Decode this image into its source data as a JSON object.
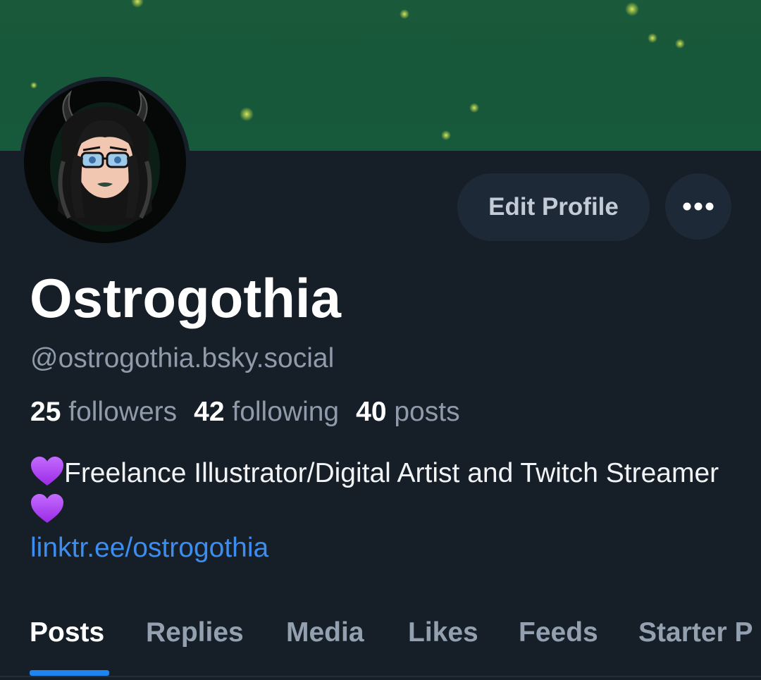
{
  "profile": {
    "display_name": "Ostrogothia",
    "handle": "@ostrogothia.bsky.social",
    "avatar_icon": "avatar-illustration",
    "banner_color": "#17573a"
  },
  "actions": {
    "edit_label": "Edit Profile",
    "more_icon": "ellipsis-icon"
  },
  "stats": {
    "followers_count": "25",
    "followers_label": "followers",
    "following_count": "42",
    "following_label": "following",
    "posts_count": "40",
    "posts_label": "posts"
  },
  "bio": {
    "text": "Freelance Illustrator/Digital Artist and Twitch Streamer",
    "emoji": "purple-heart",
    "link": "linktr.ee/ostrogothia"
  },
  "tabs": [
    {
      "label": "Posts",
      "active": true
    },
    {
      "label": "Replies",
      "active": false
    },
    {
      "label": "Media",
      "active": false
    },
    {
      "label": "Likes",
      "active": false
    },
    {
      "label": "Feeds",
      "active": false
    },
    {
      "label": "Starter P",
      "active": false
    }
  ],
  "colors": {
    "accent": "#1e84f0",
    "link": "#3b8ef0",
    "background": "#161e27"
  }
}
